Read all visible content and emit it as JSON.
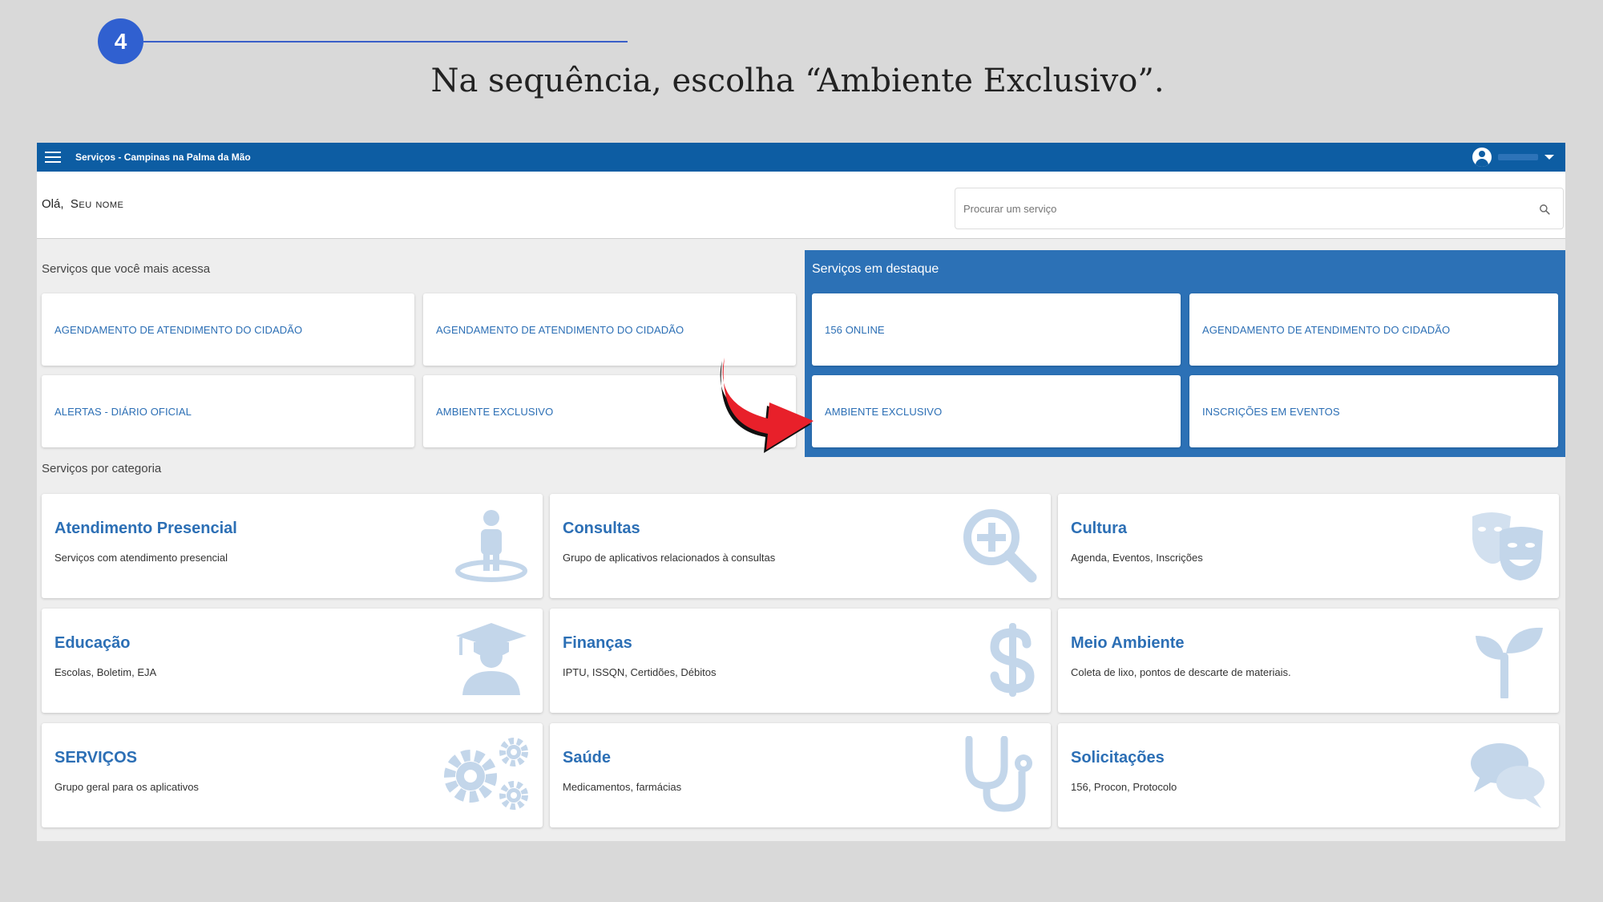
{
  "step": {
    "number": "4",
    "instruction": "Na sequência, escolha “Ambiente Exclusivo”."
  },
  "topbar": {
    "title": "Serviços - Campinas na Palma da Mão"
  },
  "greeting": {
    "hello": "Olá,",
    "name": "Seu nome"
  },
  "search": {
    "placeholder": "Procurar um serviço"
  },
  "most_accessed": {
    "title": "Serviços que você mais acessa",
    "items": [
      "AGENDAMENTO DE ATENDIMENTO DO CIDADÃO",
      "AGENDAMENTO DE ATENDIMENTO DO CIDADÃO",
      "ALERTAS - DIÁRIO OFICIAL",
      "AMBIENTE EXCLUSIVO"
    ]
  },
  "featured": {
    "title": "Serviços em destaque",
    "items": [
      "156 ONLINE",
      "AGENDAMENTO DE ATENDIMENTO DO CIDADÃO",
      "AMBIENTE EXCLUSIVO",
      "INSCRIÇÕES EM EVENTOS"
    ]
  },
  "categories": {
    "title": "Serviços por categoria",
    "items": [
      {
        "title": "Atendimento Presencial",
        "subtitle": "Serviços com atendimento presencial",
        "icon": "person-location-icon"
      },
      {
        "title": "Consultas",
        "subtitle": "Grupo de aplicativos relacionados à consultas",
        "icon": "zoom-in-icon"
      },
      {
        "title": "Cultura",
        "subtitle": "Agenda, Eventos, Inscrições",
        "icon": "theater-masks-icon"
      },
      {
        "title": "Educação",
        "subtitle": "Escolas, Boletim, EJA",
        "icon": "graduate-icon"
      },
      {
        "title": "Finanças",
        "subtitle": "IPTU, ISSQN, Certidões, Débitos",
        "icon": "dollar-icon"
      },
      {
        "title": "Meio Ambiente",
        "subtitle": "Coleta de lixo, pontos de descarte de materiais.",
        "icon": "seedling-icon"
      },
      {
        "title": "SERVIÇOS",
        "subtitle": "Grupo geral para os aplicativos",
        "icon": "gears-icon"
      },
      {
        "title": "Saúde",
        "subtitle": "Medicamentos, farmácias",
        "icon": "stethoscope-icon"
      },
      {
        "title": "Solicitações",
        "subtitle": "156, Procon, Protocolo",
        "icon": "chat-bubbles-icon"
      }
    ]
  },
  "colors": {
    "topbar": "#0d5da3",
    "featured_bg": "#2c71b6",
    "link": "#2c6fb5",
    "icon": "#c3d6ea",
    "arrow": "#e8202a"
  }
}
